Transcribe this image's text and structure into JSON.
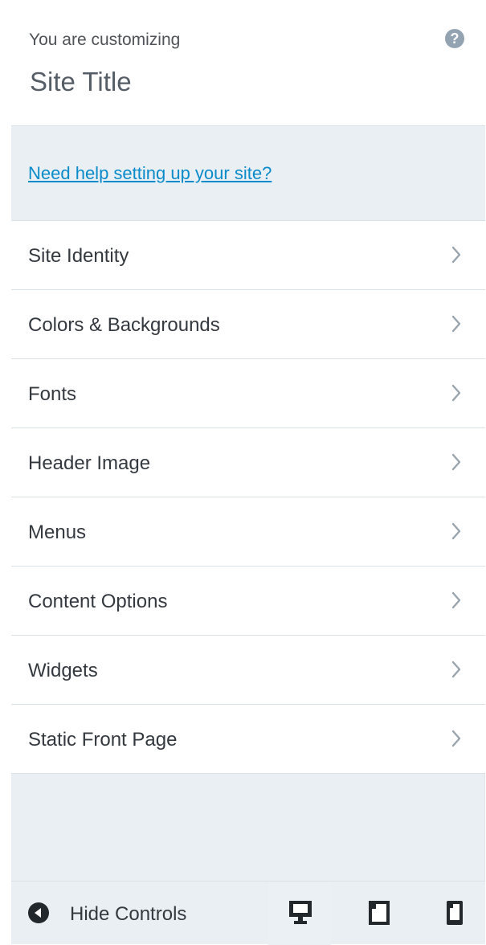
{
  "header": {
    "customizing_label": "You are customizing",
    "site_title": "Site Title",
    "help_icon": "question-mark-icon"
  },
  "help_notice": {
    "link_text": "Need help setting up your site?"
  },
  "menu": {
    "items": [
      {
        "label": "Site Identity",
        "icon": "chevron-right-icon"
      },
      {
        "label": "Colors & Backgrounds",
        "icon": "chevron-right-icon"
      },
      {
        "label": "Fonts",
        "icon": "chevron-right-icon"
      },
      {
        "label": "Header Image",
        "icon": "chevron-right-icon"
      },
      {
        "label": "Menus",
        "icon": "chevron-right-icon"
      },
      {
        "label": "Content Options",
        "icon": "chevron-right-icon"
      },
      {
        "label": "Widgets",
        "icon": "chevron-right-icon"
      },
      {
        "label": "Static Front Page",
        "icon": "chevron-right-icon"
      }
    ]
  },
  "footer": {
    "hide_controls_label": "Hide Controls",
    "collapse_icon": "arrow-left-circle-icon",
    "devices": [
      {
        "name": "desktop",
        "icon": "desktop-icon",
        "active": true
      },
      {
        "name": "tablet",
        "icon": "tablet-icon",
        "active": false
      },
      {
        "name": "mobile",
        "icon": "mobile-icon",
        "active": false
      }
    ]
  },
  "colors": {
    "link": "#0a8bca",
    "panel_background": "#eaeff3",
    "item_background": "#ffffff",
    "divider": "#d9e1e7",
    "icon_gray": "#94a3b1"
  }
}
